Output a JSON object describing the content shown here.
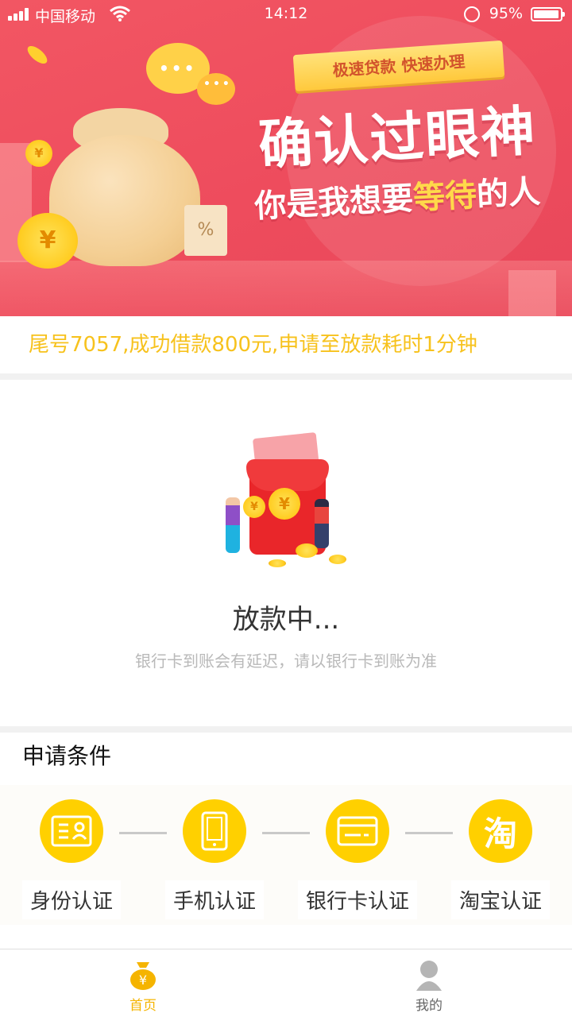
{
  "status_bar": {
    "carrier": "中国移动",
    "time": "14:12",
    "battery": "95%"
  },
  "banner": {
    "ribbon": "极速贷款 快速办理",
    "title_line1": "确认过眼神",
    "title_line2_a": "你是我想要",
    "title_line2_highlight": "等待",
    "title_line2_b": "的人",
    "coin_symbol": "¥",
    "ticket_symbol": "%",
    "bubble_dots": "•••"
  },
  "notice": "尾号7057,成功借款800元,申请至放款耗时1分钟",
  "loan_status": {
    "title": "放款中...",
    "subtitle": "银行卡到账会有延迟，请以银行卡到账为准",
    "coin_symbol": "¥"
  },
  "conditions": {
    "heading": "申请条件",
    "steps": [
      {
        "label": "身份认证",
        "icon": "id-card-icon"
      },
      {
        "label": "手机认证",
        "icon": "phone-icon"
      },
      {
        "label": "银行卡认证",
        "icon": "bank-card-icon"
      },
      {
        "label": "淘宝认证",
        "icon": "taobao-icon",
        "glyph": "淘"
      }
    ]
  },
  "tabbar": {
    "tabs": [
      {
        "label": "首页",
        "active": true,
        "icon": "money-bag-icon",
        "glyph": "¥"
      },
      {
        "label": "我的",
        "active": false,
        "icon": "user-icon"
      }
    ]
  },
  "colors": {
    "banner_red": "#ee4c5d",
    "accent_yellow": "#ffd000",
    "notice_yellow": "#f7c21d",
    "tab_active": "#f5b400"
  }
}
